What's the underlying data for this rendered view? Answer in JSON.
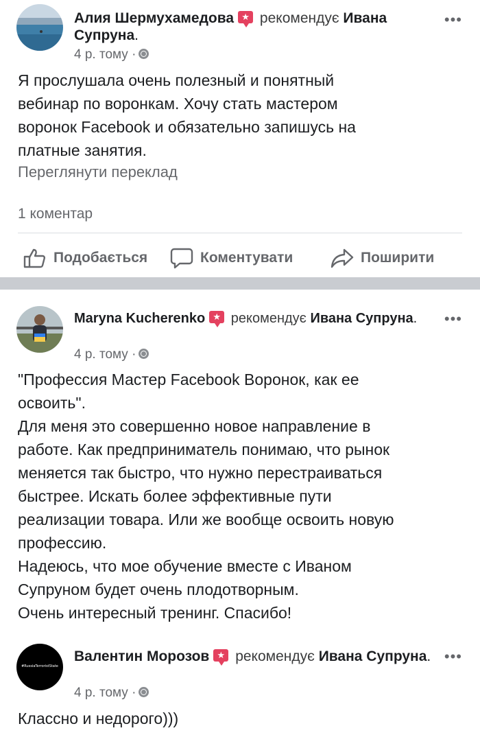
{
  "posts": [
    {
      "author": "Алия Шермухамедова",
      "badge_glyph": "★",
      "recommends": "рекомендує",
      "target": "Ивана Супруна",
      "dot": ".",
      "time": "4 р. тому",
      "separator": "·",
      "more_label": "•••",
      "text": "Я прослушала очень полезный и понятный\nвебинар по воронкам. Хочу стать мастером\nворонок Facebook и обязательно запишусь на\nплатные занятия.",
      "translate": "Переглянути переклад",
      "comments": "1 коментар",
      "actions": {
        "like": "Подобається",
        "comment": "Коментувати",
        "share": "Поширити"
      }
    },
    {
      "author": "Maryna Kucherenko",
      "badge_glyph": "★",
      "recommends": "рекомендує",
      "target": "Ивана Супруна",
      "dot": ".",
      "time": "4 р. тому",
      "separator": "·",
      "more_label": "•••",
      "text": "\"Профессия Мастер Facebook Воронок, как ее\nосвоить\".\nДля меня это совершенно новое направление в\nработе. Как предприниматель понимаю, что рынок\nменяется так быстро, что нужно перестраиваться\nбыстрее. Искать более эффективные пути\nреализации товара. Или же вообще освоить новую\nпрофессию.\nНадеюсь, что мое обучение вместе с Иваном\nСупруном будет очень плодотворным.\nОчень интересный тренинг. Спасибо!"
    },
    {
      "author": "Валентин Морозов",
      "badge_glyph": "★",
      "recommends": "рекомендує",
      "target": "Ивана Супруна",
      "dot": ".",
      "time": "4 р. тому",
      "separator": "·",
      "more_label": "•••",
      "avatar_text": "#RussiaTerroristState",
      "text": "Классно и недорого)))"
    }
  ],
  "colors": {
    "badge": "#e4415f",
    "secondary_text": "#65676b",
    "separator": "#c9ccd1"
  }
}
